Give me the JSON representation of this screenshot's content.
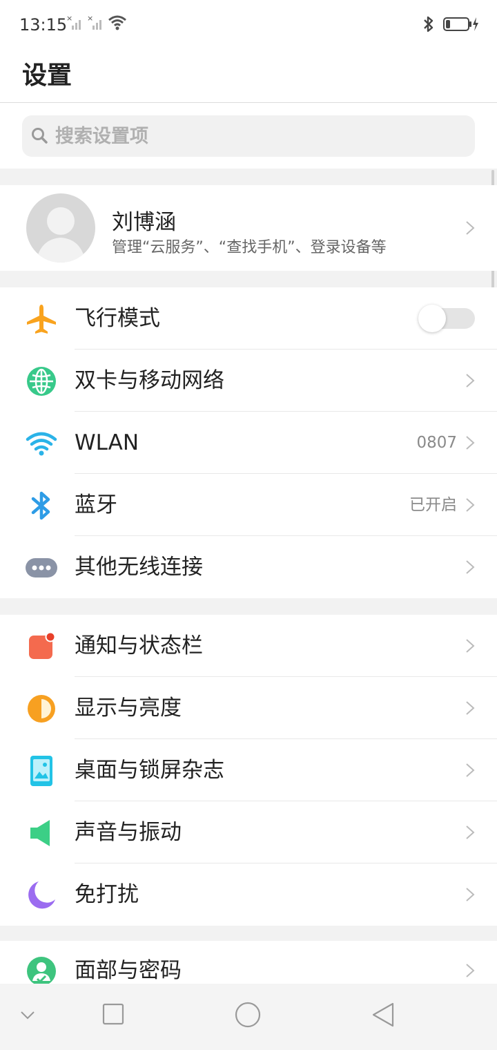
{
  "status_bar": {
    "time": "13:15"
  },
  "header": {
    "title": "设置"
  },
  "search": {
    "placeholder": "搜索设置项"
  },
  "account": {
    "name": "刘博涵",
    "subtitle": "管理“云服务”、“查找手机”、登录设备等"
  },
  "group1": [
    {
      "label": "飞行模式",
      "icon": "airplane-icon",
      "toggle": "off"
    },
    {
      "label": "双卡与移动网络",
      "icon": "globe-icon"
    },
    {
      "label": "WLAN",
      "icon": "wifi-icon",
      "value": "0807"
    },
    {
      "label": "蓝牙",
      "icon": "bluetooth-icon",
      "value": "已开启"
    },
    {
      "label": "其他无线连接",
      "icon": "more-dots-icon"
    }
  ],
  "group2": [
    {
      "label": "通知与状态栏",
      "icon": "notification-icon"
    },
    {
      "label": "显示与亮度",
      "icon": "brightness-icon"
    },
    {
      "label": "桌面与锁屏杂志",
      "icon": "wallpaper-icon"
    },
    {
      "label": "声音与振动",
      "icon": "speaker-icon"
    },
    {
      "label": "免打扰",
      "icon": "moon-icon"
    }
  ],
  "group3": [
    {
      "label": "面部与密码",
      "icon": "face-lock-icon"
    }
  ],
  "colors": {
    "airplane": "#f9a31e",
    "globe": "#38c98a",
    "wifi": "#2bb3e8",
    "bluetooth": "#2e9ce6",
    "notification": "#f46a4e",
    "brightness": "#f7a021",
    "wallpaper": "#22c3e6",
    "speaker": "#3ccf86",
    "moon": "#9b6cf0",
    "face": "#3ec47e"
  }
}
